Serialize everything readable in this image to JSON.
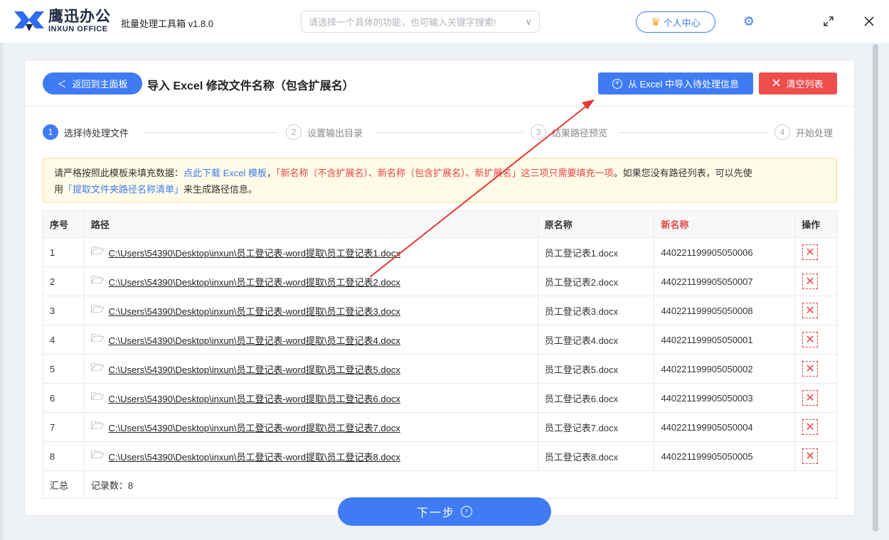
{
  "app": {
    "logo_cn": "鹰迅办公",
    "logo_en": "INXUN OFFICE",
    "title": "批量处理工具箱 v1.8.0",
    "search_placeholder": "请选择一个具体的功能，也可输入关键字搜索!",
    "user_center": "个人中心"
  },
  "header": {
    "back_label": "返回到主面板",
    "page_title": "导入 Excel 修改文件名称（包含扩展名）",
    "import_label": "从 Excel 中导入待处理信息",
    "clear_label": "清空列表"
  },
  "steps": [
    {
      "num": "1",
      "label": "选择待处理文件"
    },
    {
      "num": "2",
      "label": "设置输出目录"
    },
    {
      "num": "3",
      "label": "结果路径预览"
    },
    {
      "num": "4",
      "label": "开始处理"
    }
  ],
  "notice": {
    "p1": "请严格按照此模板来填充数据：",
    "link1": "点此下载 Excel 模板",
    "p2": "，",
    "red": "「新名称（不含扩展名）、新名称（包含扩展名）、新扩展名」这三项只需要填充一项",
    "p3": "。如果您没有路径列表，可以先使",
    "p4": "用",
    "link2": "「提取文件夹路径名称清单」",
    "p5": "来生成路径信息。"
  },
  "table": {
    "headers": {
      "index": "序号",
      "path": "路径",
      "orig": "原名称",
      "new": "新名称",
      "ops": "操作"
    },
    "rows": [
      {
        "index": "1",
        "path": "C:\\Users\\54390\\Desktop\\inxun\\员工登记表-word提取\\员工登记表1.docx",
        "orig": "员工登记表1.docx",
        "new": "440221199905050006"
      },
      {
        "index": "2",
        "path": "C:\\Users\\54390\\Desktop\\inxun\\员工登记表-word提取\\员工登记表2.docx",
        "orig": "员工登记表2.docx",
        "new": "440221199905050007"
      },
      {
        "index": "3",
        "path": "C:\\Users\\54390\\Desktop\\inxun\\员工登记表-word提取\\员工登记表3.docx",
        "orig": "员工登记表3.docx",
        "new": "440221199905050008"
      },
      {
        "index": "4",
        "path": "C:\\Users\\54390\\Desktop\\inxun\\员工登记表-word提取\\员工登记表4.docx",
        "orig": "员工登记表4.docx",
        "new": "440221199905050001"
      },
      {
        "index": "5",
        "path": "C:\\Users\\54390\\Desktop\\inxun\\员工登记表-word提取\\员工登记表5.docx",
        "orig": "员工登记表5.docx",
        "new": "440221199905050002"
      },
      {
        "index": "6",
        "path": "C:\\Users\\54390\\Desktop\\inxun\\员工登记表-word提取\\员工登记表6.docx",
        "orig": "员工登记表6.docx",
        "new": "440221199905050003"
      },
      {
        "index": "7",
        "path": "C:\\Users\\54390\\Desktop\\inxun\\员工登记表-word提取\\员工登记表7.docx",
        "orig": "员工登记表7.docx",
        "new": "440221199905050004"
      },
      {
        "index": "8",
        "path": "C:\\Users\\54390\\Desktop\\inxun\\员工登记表-word提取\\员工登记表8.docx",
        "orig": "员工登记表8.docx",
        "new": "440221199905050005"
      }
    ],
    "footer": {
      "label": "汇总",
      "count": "记录数：8"
    }
  },
  "next_label": "下一步",
  "colors": {
    "accent": "#3f7cf4",
    "danger": "#f04d4d",
    "notice_bg": "#fffbe7"
  }
}
